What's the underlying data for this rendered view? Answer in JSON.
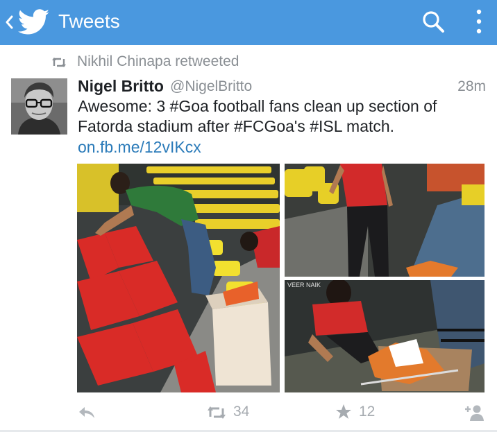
{
  "appbar": {
    "title": "Tweets",
    "icons": [
      "chevron-left-icon",
      "twitter-bird-icon",
      "search-icon",
      "overflow-menu-icon"
    ],
    "color": "#4a98df"
  },
  "retweet_context": {
    "text": "Nikhil Chinapa retweeted",
    "icon": "retweet-icon"
  },
  "tweet": {
    "author_name": "Nigel Britto",
    "author_handle": "@NigelBritto",
    "timestamp": "28m",
    "text": "Awesome: 3 #Goa football fans clean up section of Fatorda stadium after #FCGoa's #ISL match.",
    "link": "on.fb.me/12vIKcx",
    "photo_count": 3,
    "photo_c_watermark": "VEER NAIK"
  },
  "actions": {
    "retweet_count": "34",
    "favorite_count": "12",
    "icons": [
      "reply-icon",
      "retweet-icon",
      "star-icon",
      "follow-icon"
    ]
  },
  "colors": {
    "link": "#2b7bb9",
    "muted": "#8a8f94",
    "text": "#1e2125"
  }
}
